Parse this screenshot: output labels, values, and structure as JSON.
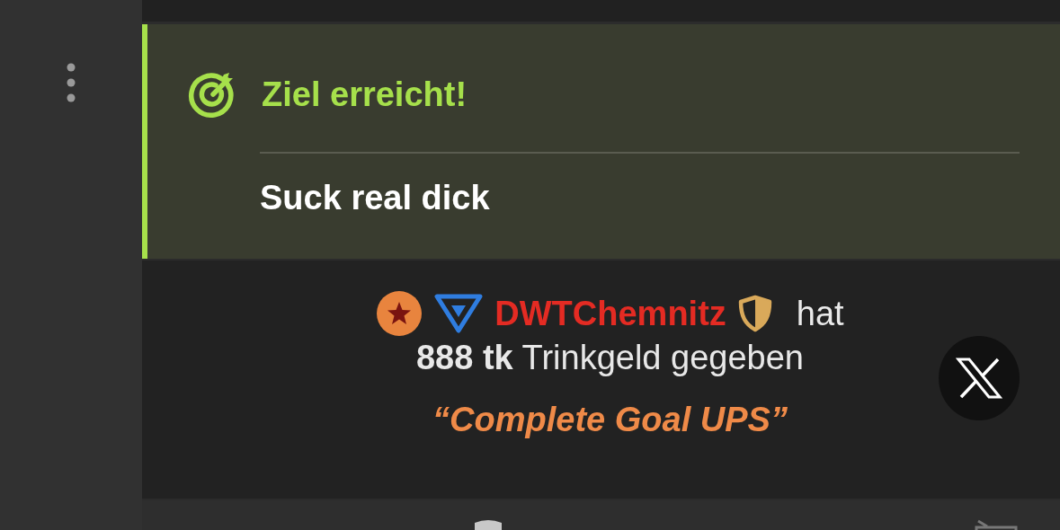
{
  "goal": {
    "title": "Ziel erreicht!",
    "message": "Suck real dick"
  },
  "tip": {
    "username": "DWTChemnitz",
    "verb": "hat",
    "text": "**888 tk** Trinkgeld gegeben",
    "quote": "“Complete Goal UPS”"
  }
}
